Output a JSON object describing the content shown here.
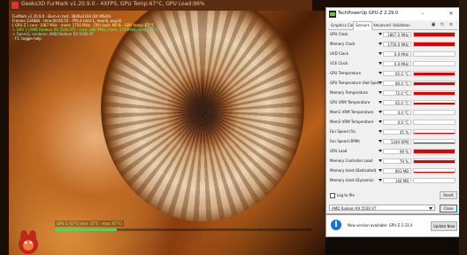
{
  "furmark": {
    "title": "Geeks3D FurMark v1.20.9.0 - 4XFPS, GPU Temp:67°C, GPU Load:99%",
    "osd": [
      {
        "text": "FurMark v1.20.9.0 - Burn-in test, 3840x2160 (0X MSAA)",
        "color": "#ffffff"
      },
      {
        "text": "Frames:124880 - time:00:05:55 - FPS:4 (min:1, max:6, avg:4)",
        "color": "#ffffff"
      },
      {
        "text": "[ GPU-Z ] core: 1087 MHz - mem: 1750 MHz - GPU load: 99 % - GPU temp: 67 °C",
        "color": "#ffff66"
      },
      {
        "text": "> GPU 1 (AMD Radeon RX 5500 XT) - core: 1867MHz, mem: 1750MHz, temp: 67°C",
        "color": "#66ff66"
      },
      {
        "text": "> OpenGL renderer: AMD Radeon RX 5500 XT",
        "color": "#66ffff"
      },
      {
        "text": "- F1: toggle help",
        "color": "#ffffff"
      }
    ],
    "fps_overlay": "GPU 1: 67°C (min: 37°C - max: 67°C)",
    "fps_bar_fraction": 0.24
  },
  "gpuz": {
    "title": "TechPowerUp GPU-Z 2.29.0",
    "tabs": [
      "Graphics Card",
      "Sensors",
      "Advanced",
      "Validation"
    ],
    "active_tab": "Sensors",
    "accent_color": "#e10000",
    "sensors": [
      {
        "name": "GPU Clock",
        "value": "1867.0 MHz",
        "level": 0.95
      },
      {
        "name": "Memory Clock",
        "value": "1750.0 MHz",
        "level": 0.95
      },
      {
        "name": "UVD Clock",
        "value": "0.0 MHz",
        "level": 0
      },
      {
        "name": "VCE Clock",
        "value": "0.0 MHz",
        "level": 0
      },
      {
        "name": "GPU Temperature",
        "value": "65.0 °C",
        "level": 0.7
      },
      {
        "name": "GPU Temperature (Hot Spot)",
        "value": "80.0 °C",
        "level": 0.8
      },
      {
        "name": "Memory Temperature",
        "value": "72.0 °C",
        "level": 0.72
      },
      {
        "name": "GPU VRM Temperature",
        "value": "65.0 °C",
        "level": 0.62
      },
      {
        "name": "Mem1 VRM Temperature",
        "value": "0.0 °C",
        "level": 0
      },
      {
        "name": "Mem2 VRM Temperature",
        "value": "0.0 °C",
        "level": 0
      },
      {
        "name": "Fan Speed (%)",
        "value": "45 %",
        "level": 0.3
      },
      {
        "name": "Fan Speed (RPM)",
        "value": "1349 RPM",
        "level": 0.3
      },
      {
        "name": "GPU Load",
        "value": "99 %",
        "level": 0.95
      },
      {
        "name": "Memory Controller Load",
        "value": "79 %",
        "level": 0.75
      },
      {
        "name": "Memory Used (Dedicated)",
        "value": "803 MB",
        "level": 0.2
      },
      {
        "name": "Memory Used (Dynamic)",
        "value": "146 MB",
        "level": 0.05
      }
    ],
    "log_to_file_label": "Log to file",
    "reset_label": "Reset",
    "gpu_select_value": "AMD Radeon RX 5500 XT",
    "close_label": "Close"
  },
  "update": {
    "message": "New version available: GPU-Z 2.33.0",
    "button_label": "Update Now"
  },
  "icons": {
    "info": "info-icon",
    "camera": "camera-icon",
    "refresh": "refresh-icon",
    "menu": "menu-icon"
  }
}
